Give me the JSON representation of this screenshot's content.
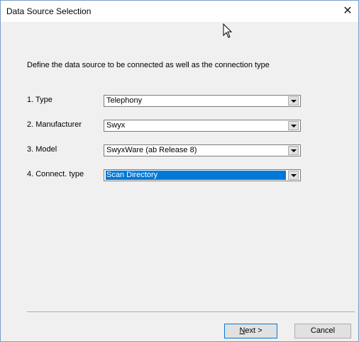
{
  "window": {
    "title": "Data Source Selection",
    "close_glyph": "✕"
  },
  "description": "Define the data source to be connected as well as the connection type",
  "fields": [
    {
      "label": "1. Type",
      "value": "Telephony"
    },
    {
      "label": "2. Manufacturer",
      "value": "Swyx"
    },
    {
      "label": "3. Model",
      "value": "SwyxWare (ab Release 8)"
    },
    {
      "label": "4. Connect. type",
      "value": "Scan Directory",
      "selected": true
    }
  ],
  "buttons": {
    "next_mnemonic": "N",
    "next_rest": "ext >",
    "cancel": "Cancel"
  },
  "colors": {
    "selection": "#0078d7",
    "dialog_bg": "#f0f0f0"
  },
  "icons": {
    "cursor": "mouse-pointer-icon",
    "close": "close-icon",
    "dropdown": "chevron-down-icon"
  }
}
